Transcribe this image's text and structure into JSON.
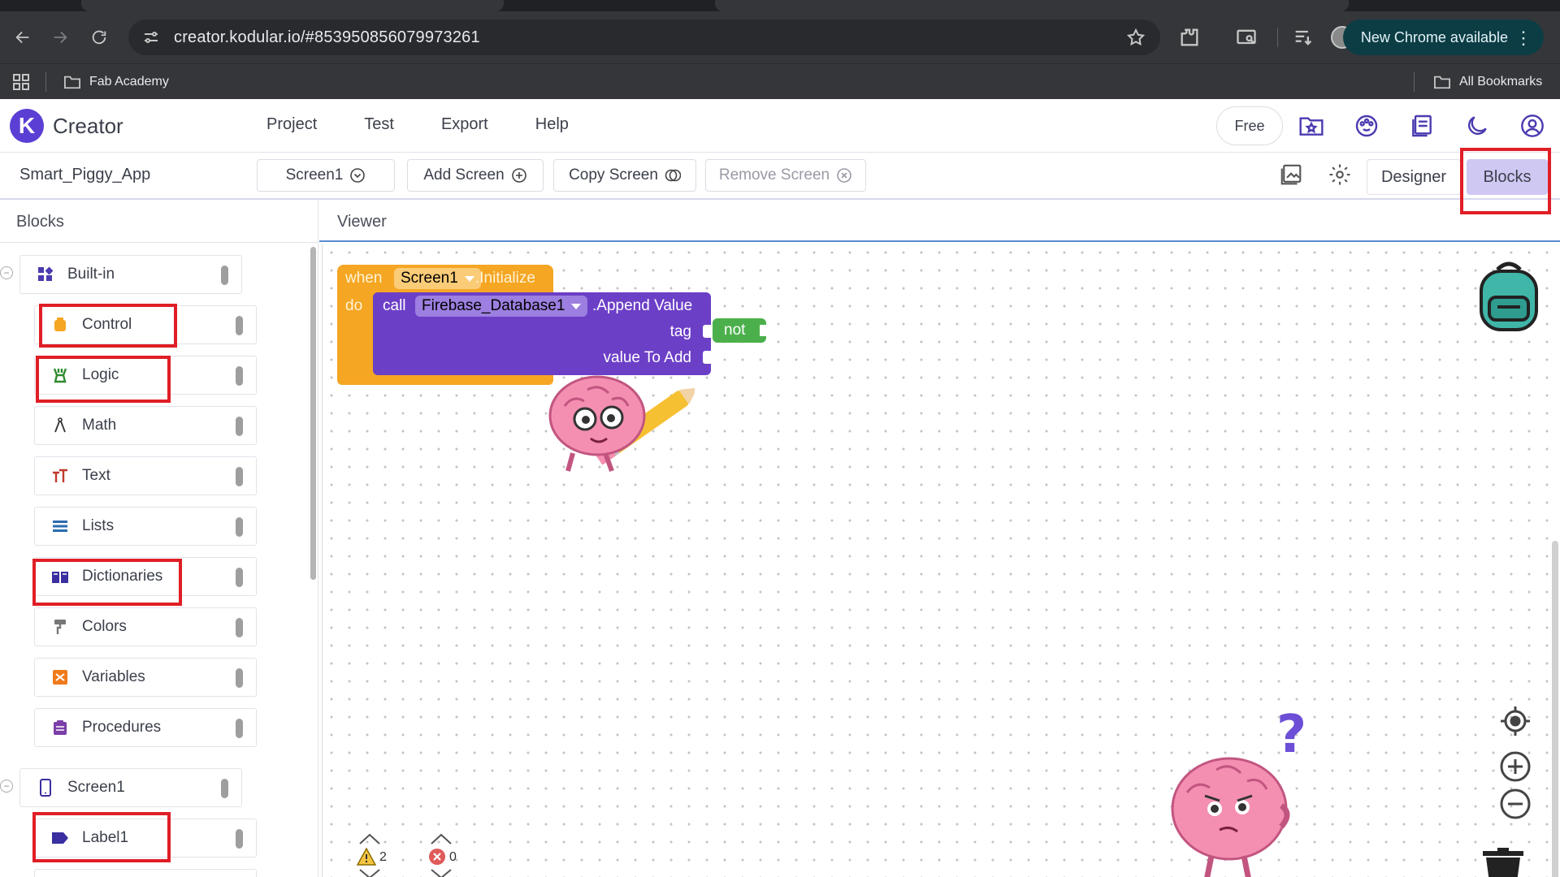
{
  "browser": {
    "url": "creator.kodular.io/#853950856079973261",
    "new_chrome_label": "New Chrome available",
    "bookmarks": [
      "Fab Academy"
    ],
    "all_bookmarks_label": "All Bookmarks"
  },
  "app": {
    "logo_letter": "K",
    "name": "Creator",
    "menu": [
      "Project",
      "Test",
      "Export",
      "Help"
    ],
    "plan_label": "Free"
  },
  "screen_bar": {
    "project_name": "Smart_Piggy_App",
    "current_screen": "Screen1",
    "add_screen": "Add Screen",
    "copy_screen": "Copy Screen",
    "remove_screen": "Remove Screen",
    "designer": "Designer",
    "blocks": "Blocks"
  },
  "blocks_panel": {
    "title": "Blocks",
    "builtin_label": "Built-in",
    "builtin_items": [
      "Control",
      "Logic",
      "Math",
      "Text",
      "Lists",
      "Dictionaries",
      "Colors",
      "Variables",
      "Procedures"
    ],
    "screen_label": "Screen1",
    "component_items": [
      "Label1"
    ]
  },
  "viewer": {
    "title": "Viewer",
    "event_block": {
      "when": "when",
      "component": "Screen1",
      "event": ".Initialize",
      "do": "do"
    },
    "call_block": {
      "call": "call",
      "component": "Firebase_Database1",
      "method": ".Append Value",
      "arg1": "tag",
      "arg2": "value To Add"
    },
    "not_block": "not",
    "warnings_count": "2",
    "errors_count": "0",
    "question_mark": "?"
  },
  "colors": {
    "accent": "#5b3fd4",
    "control_block": "#f5a623",
    "call_block": "#6c3fc7",
    "logic_block": "#4bb04b",
    "highlight": "#e01e26"
  }
}
